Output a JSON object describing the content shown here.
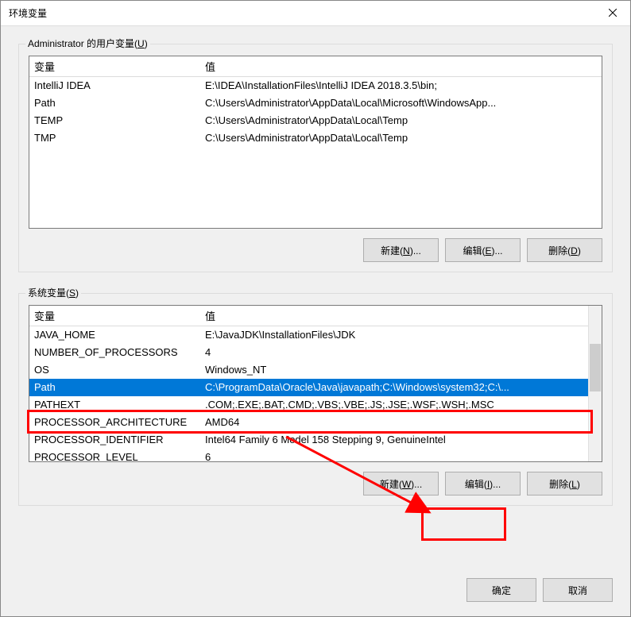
{
  "titlebar": {
    "title": "环境变量"
  },
  "user_section": {
    "legend_prefix": "Administrator 的用户变量(",
    "legend_key": "U",
    "legend_suffix": ")",
    "col_var": "变量",
    "col_val": "值",
    "rows": [
      {
        "var": "IntelliJ IDEA",
        "val": "E:\\IDEA\\InstallationFiles\\IntelliJ IDEA 2018.3.5\\bin;"
      },
      {
        "var": "Path",
        "val": "C:\\Users\\Administrator\\AppData\\Local\\Microsoft\\WindowsApp..."
      },
      {
        "var": "TEMP",
        "val": "C:\\Users\\Administrator\\AppData\\Local\\Temp"
      },
      {
        "var": "TMP",
        "val": "C:\\Users\\Administrator\\AppData\\Local\\Temp"
      }
    ],
    "buttons": {
      "new_prefix": "新建(",
      "new_key": "N",
      "new_suffix": ")...",
      "edit_prefix": "编辑(",
      "edit_key": "E",
      "edit_suffix": ")...",
      "del_prefix": "删除(",
      "del_key": "D",
      "del_suffix": ")"
    }
  },
  "sys_section": {
    "legend_prefix": "系统变量(",
    "legend_key": "S",
    "legend_suffix": ")",
    "col_var": "变量",
    "col_val": "值",
    "rows": [
      {
        "var": "JAVA_HOME",
        "val": "E:\\JavaJDK\\InstallationFiles\\JDK",
        "sel": false
      },
      {
        "var": "NUMBER_OF_PROCESSORS",
        "val": "4",
        "sel": false
      },
      {
        "var": "OS",
        "val": "Windows_NT",
        "sel": false
      },
      {
        "var": "Path",
        "val": "C:\\ProgramData\\Oracle\\Java\\javapath;C:\\Windows\\system32;C:\\...",
        "sel": true
      },
      {
        "var": "PATHEXT",
        "val": ".COM;.EXE;.BAT;.CMD;.VBS;.VBE;.JS;.JSE;.WSF;.WSH;.MSC",
        "sel": false
      },
      {
        "var": "PROCESSOR_ARCHITECTURE",
        "val": "AMD64",
        "sel": false
      },
      {
        "var": "PROCESSOR_IDENTIFIER",
        "val": "Intel64 Family 6 Model 158 Stepping 9, GenuineIntel",
        "sel": false
      },
      {
        "var": "PROCESSOR_LEVEL",
        "val": "6",
        "sel": false
      }
    ],
    "buttons": {
      "new_prefix": "新建(",
      "new_key": "W",
      "new_suffix": ")...",
      "edit_prefix": "编辑(",
      "edit_key": "I",
      "edit_suffix": ")...",
      "del_prefix": "删除(",
      "del_key": "L",
      "del_suffix": ")"
    }
  },
  "footer": {
    "ok": "确定",
    "cancel": "取消"
  }
}
